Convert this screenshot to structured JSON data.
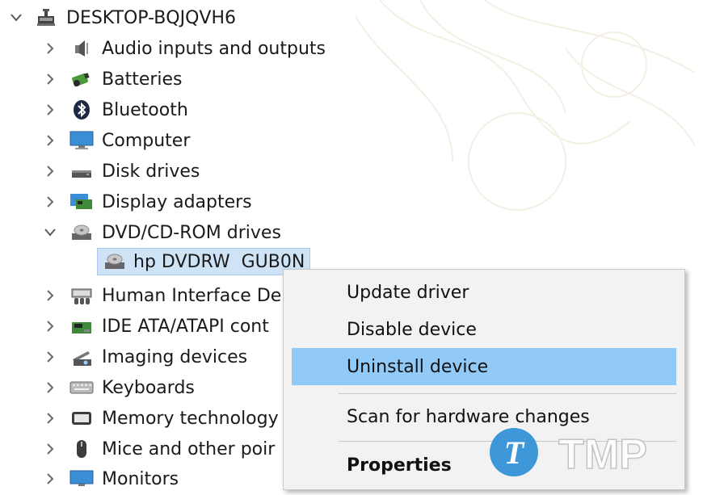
{
  "tree": {
    "root": {
      "label": "DESKTOP-BQJQVH6",
      "expanded": true,
      "icon": "computer-network-icon"
    },
    "categories": [
      {
        "label": "Audio inputs and outputs",
        "expanded": false,
        "icon": "speaker-icon"
      },
      {
        "label": "Batteries",
        "expanded": false,
        "icon": "battery-icon"
      },
      {
        "label": "Bluetooth",
        "expanded": false,
        "icon": "bluetooth-icon"
      },
      {
        "label": "Computer",
        "expanded": false,
        "icon": "monitor-icon"
      },
      {
        "label": "Disk drives",
        "expanded": false,
        "icon": "disk-drive-icon"
      },
      {
        "label": "Display adapters",
        "expanded": false,
        "icon": "display-adapter-icon"
      },
      {
        "label": "DVD/CD-ROM drives",
        "expanded": true,
        "icon": "dvd-drive-icon"
      },
      {
        "label": "Human Interface De",
        "expanded": false,
        "icon": "hid-icon"
      },
      {
        "label": "IDE ATA/ATAPI cont",
        "expanded": false,
        "icon": "ide-controller-icon"
      },
      {
        "label": "Imaging devices",
        "expanded": false,
        "icon": "imaging-icon"
      },
      {
        "label": "Keyboards",
        "expanded": false,
        "icon": "keyboard-icon"
      },
      {
        "label": "Memory technology",
        "expanded": false,
        "icon": "memory-icon"
      },
      {
        "label": "Mice and other poir",
        "expanded": false,
        "icon": "mouse-icon"
      },
      {
        "label": "Monitors",
        "expanded": false,
        "icon": "monitor-icon"
      }
    ],
    "selected_device": {
      "label": "hp DVDRW  GUB0N",
      "icon": "dvd-drive-icon"
    }
  },
  "context_menu": {
    "items": [
      {
        "label": "Update driver"
      },
      {
        "label": "Disable device"
      },
      {
        "label": "Uninstall device",
        "highlighted": true
      },
      {
        "label": "Scan for hardware changes"
      },
      {
        "label": "Properties",
        "bold": true
      }
    ]
  },
  "watermark": {
    "text": "TMP",
    "logo_letter": "T"
  },
  "colors": {
    "selection": "#cfe3f7",
    "menu_highlight": "#91c9f7",
    "menu_bg": "#f2f2f2"
  }
}
